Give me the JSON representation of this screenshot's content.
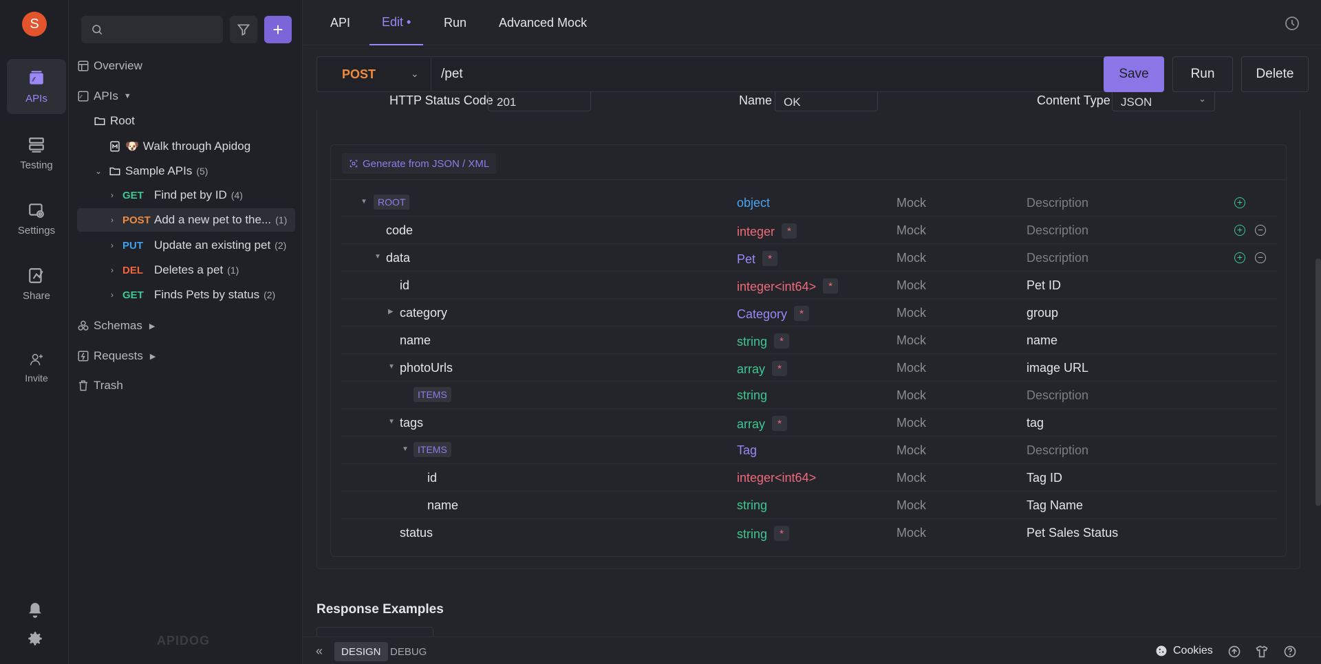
{
  "user": {
    "avatar_initial": "S"
  },
  "rail": {
    "items": [
      {
        "label": "APIs"
      },
      {
        "label": "Testing"
      },
      {
        "label": "Settings"
      },
      {
        "label": "Share"
      },
      {
        "label": "Invite"
      }
    ]
  },
  "sidebar": {
    "search_placeholder": "",
    "overview": "Overview",
    "apis": "APIs",
    "root": "Root",
    "walkthrough": "Walk through Apidog",
    "sample_apis": "Sample APIs",
    "sample_apis_count": "(5)",
    "endpoints": [
      {
        "method": "GET",
        "name": "Find pet by ID",
        "count": "(4)"
      },
      {
        "method": "POST",
        "name": "Add a new pet to the...",
        "count": "(1)"
      },
      {
        "method": "PUT",
        "name": "Update an existing pet",
        "count": "(2)"
      },
      {
        "method": "DEL",
        "name": "Deletes a pet",
        "count": "(1)"
      },
      {
        "method": "GET",
        "name": "Finds Pets by status",
        "count": "(2)"
      }
    ],
    "schemas": "Schemas",
    "requests": "Requests",
    "trash": "Trash",
    "watermark": "APIDOG"
  },
  "tabs": [
    {
      "label": "API"
    },
    {
      "label": "Edit •"
    },
    {
      "label": "Run"
    },
    {
      "label": "Advanced Mock"
    }
  ],
  "request": {
    "method": "POST",
    "path": "/pet",
    "save_label": "Save",
    "run_label": "Run",
    "delete_label": "Delete"
  },
  "response": {
    "status_code_label": "HTTP Status Code",
    "status_code": "201",
    "name_label": "Name",
    "name": "OK",
    "content_type_label": "Content Type",
    "content_type": "JSON",
    "generate_label": "Generate from JSON / XML"
  },
  "schema": {
    "rows": [
      {
        "name": "ROOT",
        "type": "object",
        "mock": "Mock",
        "desc": "Description"
      },
      {
        "name": "code",
        "type": "integer",
        "mock": "Mock",
        "desc": "Description"
      },
      {
        "name": "data",
        "type": "Pet",
        "mock": "Mock",
        "desc": "Description"
      },
      {
        "name": "id",
        "type": "integer<int64>",
        "mock": "Mock",
        "desc": "Pet ID"
      },
      {
        "name": "category",
        "type": "Category",
        "mock": "Mock",
        "desc": "group"
      },
      {
        "name": "name",
        "type": "string",
        "mock": "Mock",
        "desc": "name"
      },
      {
        "name": "photoUrls",
        "type": "array",
        "mock": "Mock",
        "desc": "image URL"
      },
      {
        "name": "ITEMS",
        "type": "string",
        "mock": "Mock",
        "desc": "Description"
      },
      {
        "name": "tags",
        "type": "array",
        "mock": "Mock",
        "desc": "tag"
      },
      {
        "name": "ITEMS",
        "type": "Tag",
        "mock": "Mock",
        "desc": "Description"
      },
      {
        "name": "id",
        "type": "integer<int64>",
        "mock": "Mock",
        "desc": "Tag ID"
      },
      {
        "name": "name",
        "type": "string",
        "mock": "Mock",
        "desc": "Tag Name"
      },
      {
        "name": "status",
        "type": "string",
        "mock": "Mock",
        "desc": "Pet Sales Status"
      }
    ],
    "required_mark": "*"
  },
  "response_examples_title": "Response Examples",
  "bottom": {
    "design": "DESIGN",
    "debug": "DEBUG",
    "cookies": "Cookies"
  }
}
